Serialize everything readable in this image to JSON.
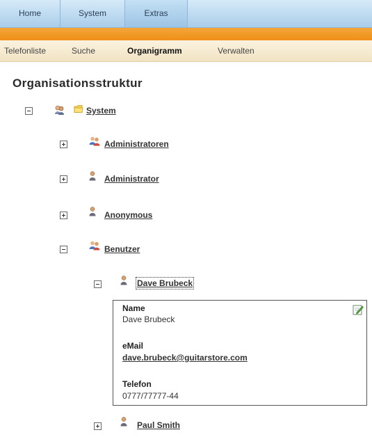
{
  "top_nav": {
    "tabs": [
      {
        "label": "Home"
      },
      {
        "label": "System"
      },
      {
        "label": "Extras"
      }
    ]
  },
  "sub_nav": {
    "items": [
      {
        "label": "Telefonliste"
      },
      {
        "label": "Suche"
      },
      {
        "label": "Organigramm",
        "active": true
      },
      {
        "label": "Verwalten"
      }
    ]
  },
  "page": {
    "title": "Organisationsstruktur"
  },
  "tree": {
    "root": {
      "label": "System",
      "expanded": true,
      "icon": "users-folder-icon"
    },
    "children": [
      {
        "label": "Administratoren",
        "expanded": false,
        "icon": "group-icon"
      },
      {
        "label": "Administrator",
        "expanded": false,
        "icon": "user-icon"
      },
      {
        "label": "Anonymous",
        "expanded": false,
        "icon": "user-icon"
      },
      {
        "label": "Benutzer",
        "expanded": true,
        "icon": "group-icon"
      }
    ],
    "benutzer_children": [
      {
        "label": "Dave Brubeck",
        "expanded": true,
        "icon": "user-icon"
      },
      {
        "label": "Paul Smith",
        "expanded": false,
        "icon": "user-icon"
      }
    ]
  },
  "detail": {
    "name_label": "Name",
    "name_value": "Dave Brubeck",
    "email_label": "eMail",
    "email_value": "dave.brubeck@guitarstore.com",
    "phone_label": "Telefon",
    "phone_value": "0777/77777-44"
  },
  "colors": {
    "nav_blue": "#a9cdea",
    "accent_orange": "#ee8f18",
    "subnav_cream": "#f1e3c2"
  }
}
